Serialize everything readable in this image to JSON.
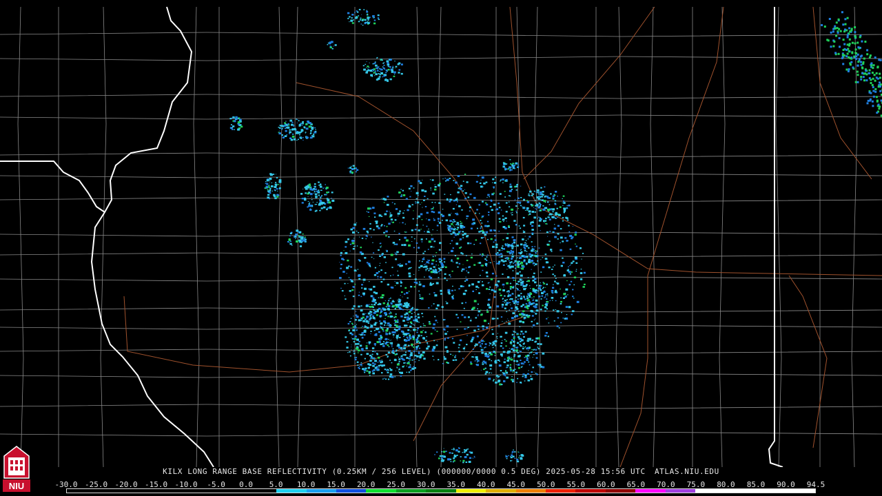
{
  "title": "KILX LONG RANGE BASE REFLECTIVITY (0.25KM / 256 LEVEL) (000000/0000 0.5 DEG) 2025-05-28 15:56 UTC",
  "credit": "ATLAS.NIU.EDU",
  "logo_text": "NIU",
  "scale": {
    "ticks": [
      "-30.0",
      "-25.0",
      "-20.0",
      "-15.0",
      "-10.0",
      "-5.0",
      "0.0",
      "5.0",
      "10.0",
      "15.0",
      "20.0",
      "25.0",
      "30.0",
      "35.0",
      "40.0",
      "45.0",
      "50.0",
      "55.0",
      "60.0",
      "65.0",
      "70.0",
      "75.0",
      "80.0",
      "85.0",
      "90.0",
      "94.5"
    ],
    "colors": [
      "#000000",
      "#000000",
      "#000000",
      "#000000",
      "#000000",
      "#000000",
      "#000000",
      "#20d0f0",
      "#1aa0f0",
      "#1050e0",
      "#10e030",
      "#0aa020",
      "#068010",
      "#f0f000",
      "#e0b000",
      "#f08000",
      "#f02000",
      "#c00000",
      "#900000",
      "#ff00ff",
      "#a040e0",
      "#ffffff",
      "#ffffff",
      "#ffffff",
      "#ffffff"
    ]
  },
  "colors": {
    "state_border": "#ffffff",
    "county_border": "#8a8a8a",
    "highway": "#a0522d",
    "echo_light": "#35c8e8",
    "echo_mid": "#1f7fe0",
    "echo_strong": "#1fd05a"
  }
}
